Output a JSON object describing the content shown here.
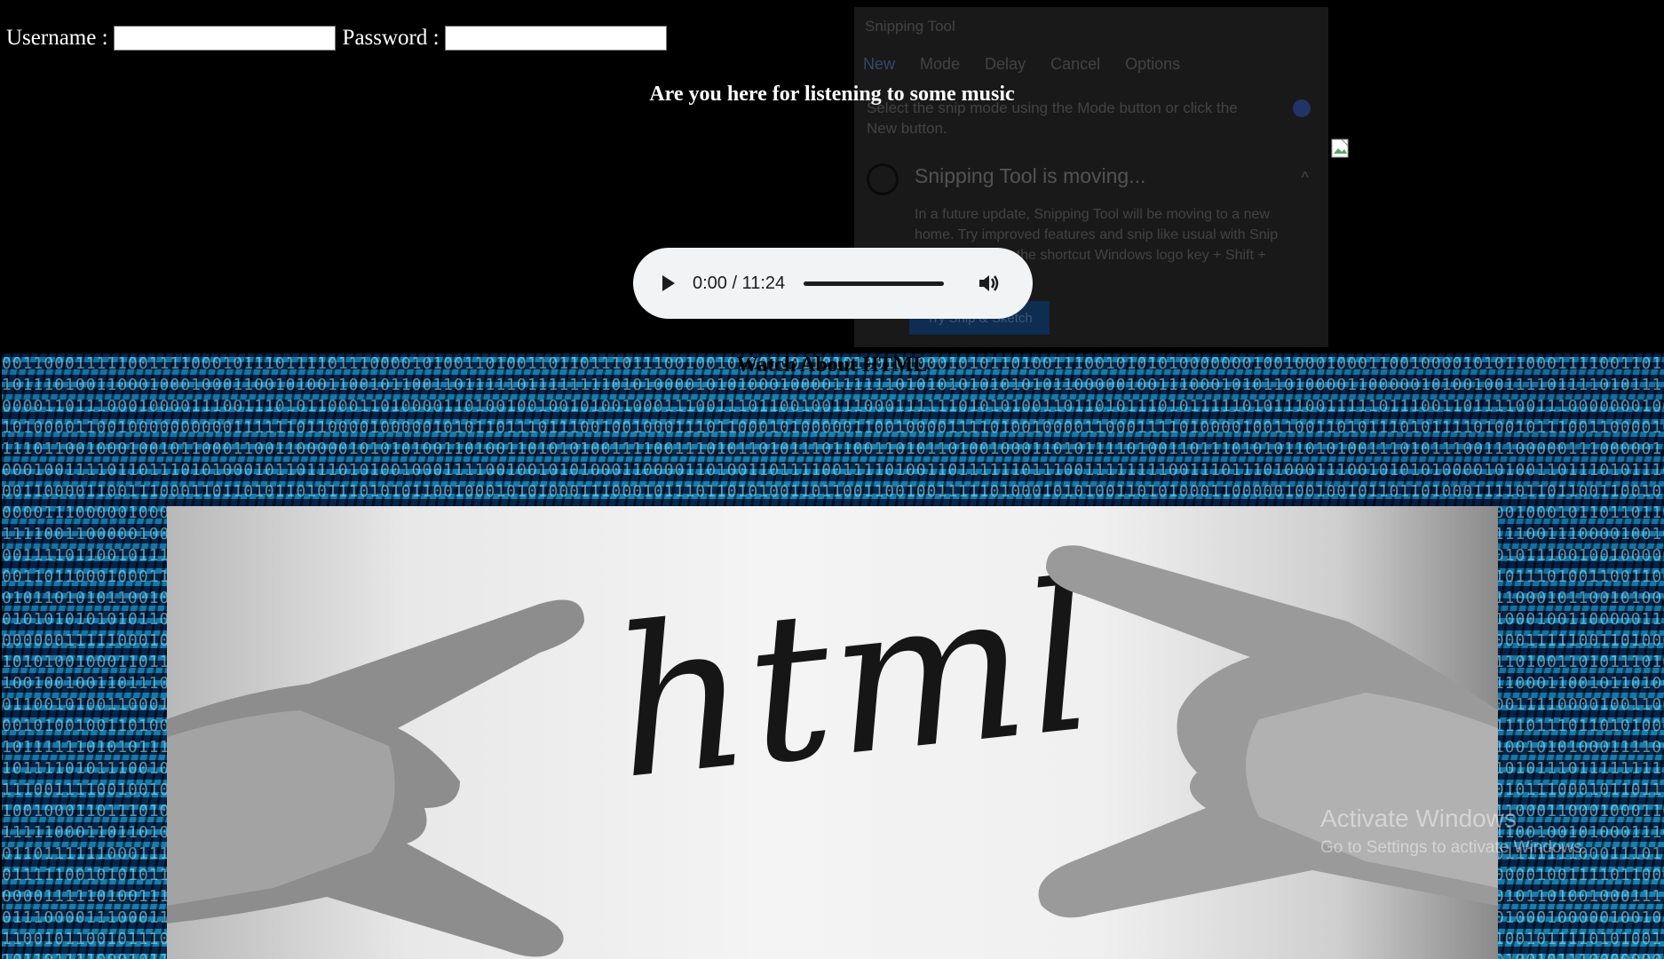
{
  "login": {
    "username_label": "Username :",
    "password_label": "Password :",
    "username_value": "",
    "password_value": ""
  },
  "music_heading": "Are you here for listening to some music",
  "audio_player": {
    "time": "0:00 / 11:24",
    "progress_fraction": 0
  },
  "snipping_tool": {
    "title": "Snipping Tool",
    "toolbar": [
      "New",
      "Mode",
      "Delay",
      "Cancel",
      "Options"
    ],
    "instructions": "Select the snip mode using the Mode button or click the New button.",
    "moving_title": "Snipping Tool is moving...",
    "moving_desc": "In a future update, Snipping Tool will be moving to a new home. Try improved features and snip like usual with Snip & Sketch (or try the shortcut Windows logo key + Shift + S).",
    "try_button": "Try Snip & Sketch"
  },
  "video_heading": "Watch About HTML",
  "image_word": "html",
  "watermark": {
    "line1": "Activate Windows",
    "line2": "Go to Settings to activate Windows."
  },
  "colors": {
    "page_bg": "#000000",
    "player_bg": "#f1f3f4",
    "binary_accent": "#1fa8d8"
  }
}
